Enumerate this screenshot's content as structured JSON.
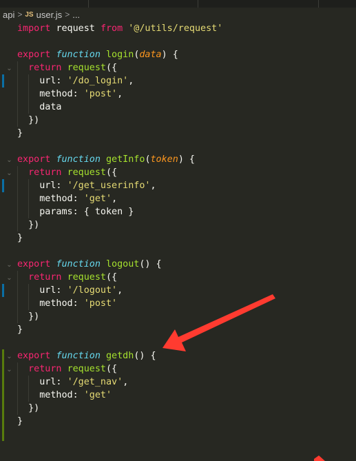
{
  "breadcrumb": {
    "folder": "api",
    "file": "user.js",
    "file_badge": "JS",
    "more": "...",
    "separator": ">"
  },
  "code": {
    "import": {
      "kw": "import",
      "name": "request",
      "from": "from",
      "path": "'@/utils/request'"
    },
    "login": {
      "export": "export",
      "function": "function",
      "name": "login",
      "param": "data",
      "return": "return",
      "call": "request",
      "url_key": "url:",
      "url_val": "'/do_login'",
      "method_key": "method:",
      "method_val": "'post'",
      "data_line": "data"
    },
    "getInfo": {
      "export": "export",
      "function": "function",
      "name": "getInfo",
      "param": "token",
      "return": "return",
      "call": "request",
      "url_key": "url:",
      "url_val": "'/get_userinfo'",
      "method_key": "method:",
      "method_val": "'get'",
      "params_line": "params: { token }"
    },
    "logout": {
      "export": "export",
      "function": "function",
      "name": "logout",
      "return": "return",
      "call": "request",
      "url_key": "url:",
      "url_val": "'/logout'",
      "method_key": "method:",
      "method_val": "'post'"
    },
    "getdh": {
      "export": "export",
      "function": "function",
      "name": "getdh",
      "return": "return",
      "call": "request",
      "url_key": "url:",
      "url_val": "'/get_nav'",
      "method_key": "method:",
      "method_val": "'get'"
    }
  },
  "colors": {
    "background": "#272822",
    "keyword": "#f92672",
    "string": "#e6db74",
    "function_name": "#a6e22e",
    "storage": "#66d9ef",
    "parameter": "#fd971f",
    "annotation_arrow": "#ff3b30"
  },
  "icons": {
    "fold": "chevron-down-icon",
    "annotation": "red-arrow-icon"
  }
}
